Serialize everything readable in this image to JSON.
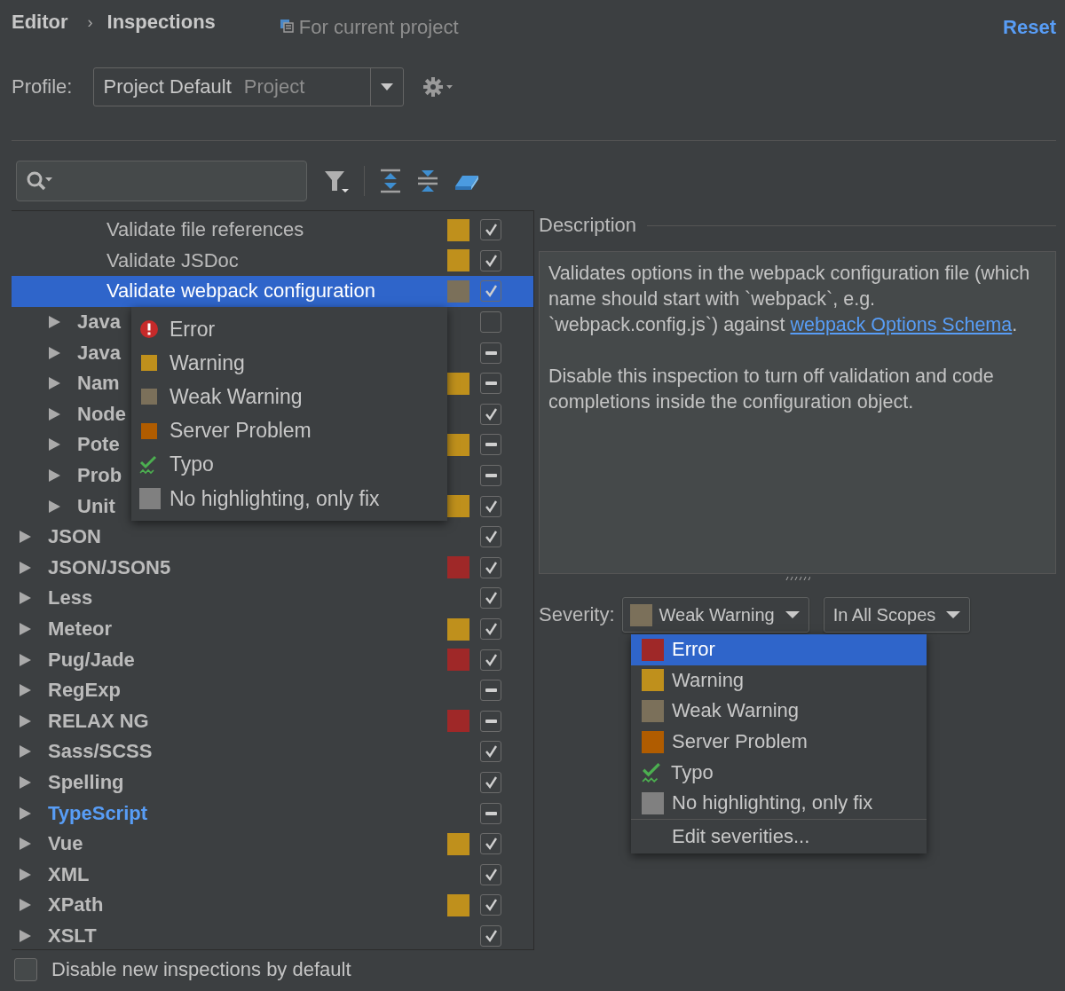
{
  "breadcrumb": {
    "parent": "Editor",
    "separator": "›",
    "current": "Inspections"
  },
  "scope": "For current project",
  "reset": "Reset",
  "profile": {
    "label": "Profile:",
    "value": "Project Default",
    "type": "Project"
  },
  "tree": [
    {
      "children": [
        {
          "children": [
            {
              "kind": "leaf",
              "label": "Validate file references",
              "color": "#bf901c",
              "checked": true,
              "partial": false,
              "selected": false,
              "modified": false
            },
            {
              "kind": "leaf",
              "label": "Validate JSDoc",
              "color": "#bf901c",
              "checked": true,
              "partial": false,
              "selected": false,
              "modified": false
            },
            {
              "kind": "leaf",
              "label": "Validate webpack configuration",
              "color": "#7b705a",
              "checked": true,
              "partial": false,
              "selected": true,
              "modified": false
            }
          ]
        },
        {
          "kind": "group",
          "label": "Java",
          "checked": false,
          "partial": false,
          "selected": false,
          "modified": false
        },
        {
          "kind": "group",
          "label": "Java",
          "checked": true,
          "partial": true,
          "selected": false,
          "modified": false
        },
        {
          "kind": "group",
          "label": "Nam",
          "color": "#bf901c",
          "checked": true,
          "partial": true,
          "selected": false,
          "modified": false
        },
        {
          "kind": "group",
          "label": "Node",
          "checked": true,
          "partial": false,
          "selected": false,
          "modified": false
        },
        {
          "kind": "group",
          "label": "Pote",
          "color": "#bf901c",
          "checked": true,
          "partial": true,
          "selected": false,
          "modified": false
        },
        {
          "kind": "group",
          "label": "Prob",
          "checked": true,
          "partial": true,
          "selected": false,
          "modified": false
        },
        {
          "kind": "group",
          "label": "Unit",
          "color": "#bf901c",
          "checked": true,
          "partial": false,
          "selected": false,
          "modified": false
        }
      ]
    },
    {
      "kind": "group",
      "label": "JSON",
      "checked": true,
      "partial": false,
      "selected": false,
      "modified": false
    },
    {
      "kind": "group",
      "label": "JSON/JSON5",
      "color": "#9f2828",
      "checked": true,
      "partial": false,
      "selected": false,
      "modified": false
    },
    {
      "kind": "group",
      "label": "Less",
      "checked": true,
      "partial": false,
      "selected": false,
      "modified": false
    },
    {
      "kind": "group",
      "label": "Meteor",
      "color": "#bf901c",
      "checked": true,
      "partial": false,
      "selected": false,
      "modified": false
    },
    {
      "kind": "group",
      "label": "Pug/Jade",
      "color": "#9f2828",
      "checked": true,
      "partial": false,
      "selected": false,
      "modified": false
    },
    {
      "kind": "group",
      "label": "RegExp",
      "checked": true,
      "partial": true,
      "selected": false,
      "modified": false
    },
    {
      "kind": "group",
      "label": "RELAX NG",
      "color": "#9f2828",
      "checked": true,
      "partial": true,
      "selected": false,
      "modified": false
    },
    {
      "kind": "group",
      "label": "Sass/SCSS",
      "checked": true,
      "partial": false,
      "selected": false,
      "modified": false
    },
    {
      "kind": "group",
      "label": "Spelling",
      "checked": true,
      "partial": false,
      "selected": false,
      "modified": false
    },
    {
      "kind": "group",
      "label": "TypeScript",
      "checked": true,
      "partial": true,
      "selected": false,
      "modified": true
    },
    {
      "kind": "group",
      "label": "Vue",
      "color": "#bf901c",
      "checked": true,
      "partial": false,
      "selected": false,
      "modified": false
    },
    {
      "kind": "group",
      "label": "XML",
      "checked": true,
      "partial": false,
      "selected": false,
      "modified": false
    },
    {
      "kind": "group",
      "label": "XPath",
      "color": "#bf901c",
      "checked": true,
      "partial": false,
      "selected": false,
      "modified": false
    },
    {
      "kind": "group",
      "label": "XSLT",
      "checked": true,
      "partial": false,
      "selected": false,
      "modified": false
    }
  ],
  "context_menu": [
    {
      "kind": "error",
      "label": "Error"
    },
    {
      "kind": "square",
      "color": "#bf901c",
      "label": "Warning"
    },
    {
      "kind": "square",
      "color": "#7b705a",
      "label": "Weak Warning"
    },
    {
      "kind": "square",
      "color": "#b05c00",
      "label": "Server Problem"
    },
    {
      "kind": "typo",
      "label": "Typo"
    },
    {
      "kind": "square",
      "color": "#808080",
      "label": "No highlighting, only fix"
    }
  ],
  "description": {
    "heading": "Description",
    "paragraphs": [
      {
        "before": "Validates options in the webpack configuration file (which name should start with `webpack`, e.g. `webpack.config.js`) against ",
        "link": "webpack Options Schema",
        "after": "."
      },
      {
        "before": "Disable this inspection to turn off validation and code completions inside the configuration object."
      }
    ]
  },
  "severity": {
    "label": "Severity:",
    "value": "Weak Warning",
    "color": "#7b705a",
    "scope": "In All Scopes",
    "options": [
      {
        "kind": "square",
        "color": "#9f2828",
        "label": "Error",
        "highlighted": true
      },
      {
        "kind": "square",
        "color": "#bf901c",
        "label": "Warning",
        "highlighted": false
      },
      {
        "kind": "square",
        "color": "#7b705a",
        "label": "Weak Warning",
        "highlighted": false
      },
      {
        "kind": "square",
        "color": "#b05c00",
        "label": "Server Problem",
        "highlighted": false
      },
      {
        "kind": "typo",
        "label": "Typo",
        "highlighted": false
      },
      {
        "kind": "square",
        "color": "#808080",
        "label": "No highlighting, only fix",
        "highlighted": false
      }
    ],
    "edit": "Edit severities..."
  },
  "disable_new": {
    "label": "Disable new inspections by default",
    "checked": false
  }
}
